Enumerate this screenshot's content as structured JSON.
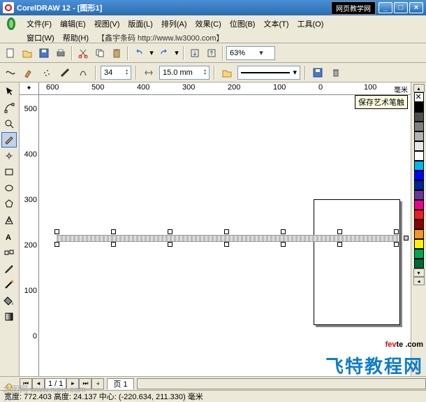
{
  "window": {
    "title": "CorelDRAW 12 - [图形1]",
    "badge": "网页教学网"
  },
  "menu": {
    "items": [
      "文件(F)",
      "编辑(E)",
      "视图(V)",
      "版面(L)",
      "排列(A)",
      "效果(C)",
      "位图(B)",
      "文本(T)",
      "工具(O)",
      "窗口(W)",
      "帮助(H)"
    ],
    "extra": "【鑫宇条码 http://www.lw3000.com】"
  },
  "toolbar": {
    "zoom": "63%"
  },
  "prop": {
    "spray_count": "34",
    "size": "15.0 mm"
  },
  "ruler": {
    "unit": "毫米",
    "top_ticks": [
      "600",
      "500",
      "400",
      "300",
      "200",
      "100",
      "0",
      "100"
    ],
    "left_ticks": [
      "500",
      "400",
      "300",
      "200",
      "100",
      "0"
    ]
  },
  "tooltip": "保存艺术笔触",
  "page": {
    "info": "1 / 1",
    "tab": "页 1"
  },
  "status": {
    "text": "宽度: 772.403  高度: 24.137  中心: (-220.634, 211.330)  毫米"
  },
  "watermark": "北图网 www.nipic.com",
  "overlay": {
    "fevte_r": "fev",
    "fevte_b": "te .com",
    "cn": "飞特教程网"
  },
  "palette": [
    "#000000",
    "#4d4d4d",
    "#808080",
    "#b3b3b3",
    "#e6e6e6",
    "#ffffff",
    "#00008b",
    "#0000ff",
    "#006400",
    "#008000",
    "#8b0000",
    "#ff0000",
    "#8b008b",
    "#ff00ff",
    "#b8860b",
    "#ffff00",
    "#ff8c00"
  ]
}
